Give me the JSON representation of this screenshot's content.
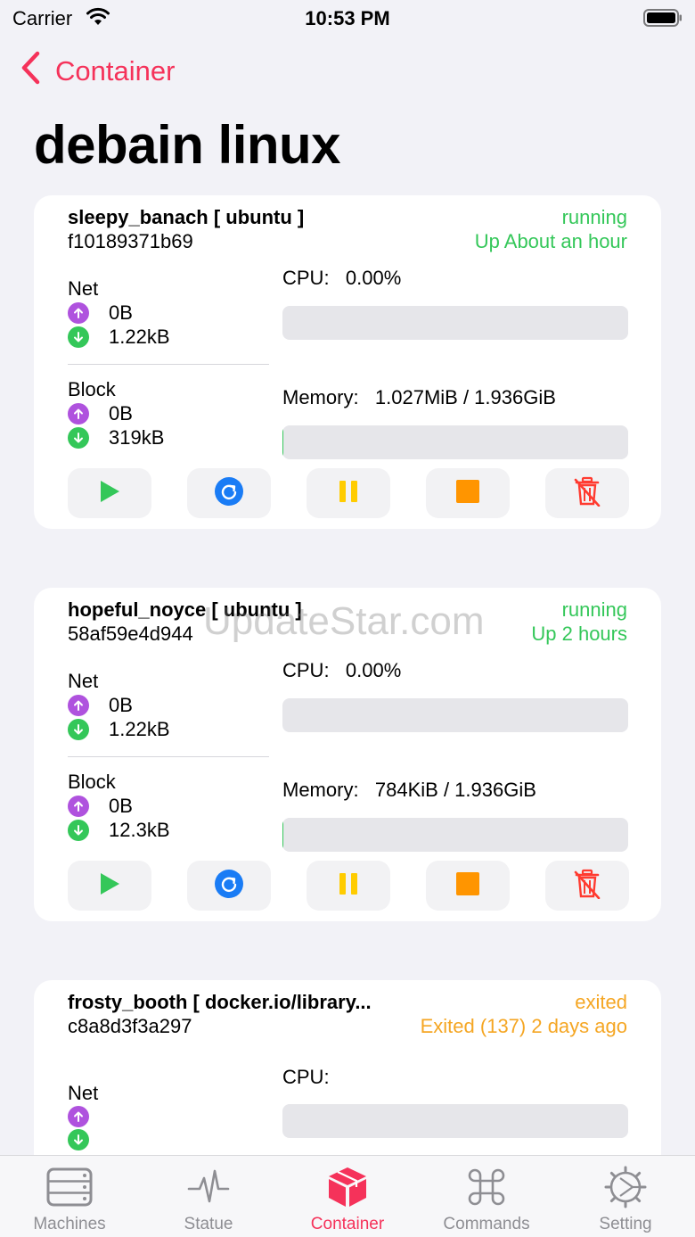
{
  "status_bar": {
    "carrier": "Carrier",
    "time": "10:53 PM"
  },
  "nav": {
    "back_label": "Container"
  },
  "page_title": "debain linux",
  "watermark": "UpdateStar.com",
  "labels": {
    "net": "Net",
    "block": "Block",
    "cpu": "CPU:",
    "memory": "Memory:"
  },
  "containers": [
    {
      "name": "sleepy_banach [ ubuntu ]",
      "id": "f10189371b69",
      "state": "running",
      "status": "Up About an hour",
      "net": {
        "up": "0B",
        "down": "1.22kB"
      },
      "block": {
        "up": "0B",
        "down": "319kB"
      },
      "cpu": "0.00%",
      "memory": "1.027MiB / 1.936GiB",
      "cpu_fraction": 0.0,
      "memory_fraction": 0.0005
    },
    {
      "name": "hopeful_noyce [ ubuntu ]",
      "id": "58af59e4d944",
      "state": "running",
      "status": "Up 2 hours",
      "net": {
        "up": "0B",
        "down": "1.22kB"
      },
      "block": {
        "up": "0B",
        "down": "12.3kB"
      },
      "cpu": "0.00%",
      "memory": "784KiB / 1.936GiB",
      "cpu_fraction": 0.0,
      "memory_fraction": 0.0004
    },
    {
      "name": "frosty_booth [ docker.io/library...",
      "id": "c8a8d3f3a297",
      "state": "exited",
      "status": "Exited (137) 2 days ago",
      "cpu": "",
      "cpu_fraction": 0.0
    }
  ],
  "actions": [
    "start-icon",
    "restart-icon",
    "pause-icon",
    "stop-icon",
    "delete-icon"
  ],
  "tabs": [
    {
      "label": "Machines",
      "icon": "server-icon",
      "active": false
    },
    {
      "label": "Statue",
      "icon": "pulse-icon",
      "active": false
    },
    {
      "label": "Container",
      "icon": "box-icon",
      "active": true
    },
    {
      "label": "Commands",
      "icon": "command-icon",
      "active": false
    },
    {
      "label": "Setting",
      "icon": "gear-icon",
      "active": false
    }
  ],
  "colors": {
    "accent": "#f5325a",
    "running": "#34c759",
    "exited": "#f5a623",
    "upload": "#af52de",
    "download": "#34c759",
    "restart": "#1a7cf5",
    "pause": "#ffcc00",
    "stop": "#ff9500",
    "delete": "#ff3b30"
  }
}
